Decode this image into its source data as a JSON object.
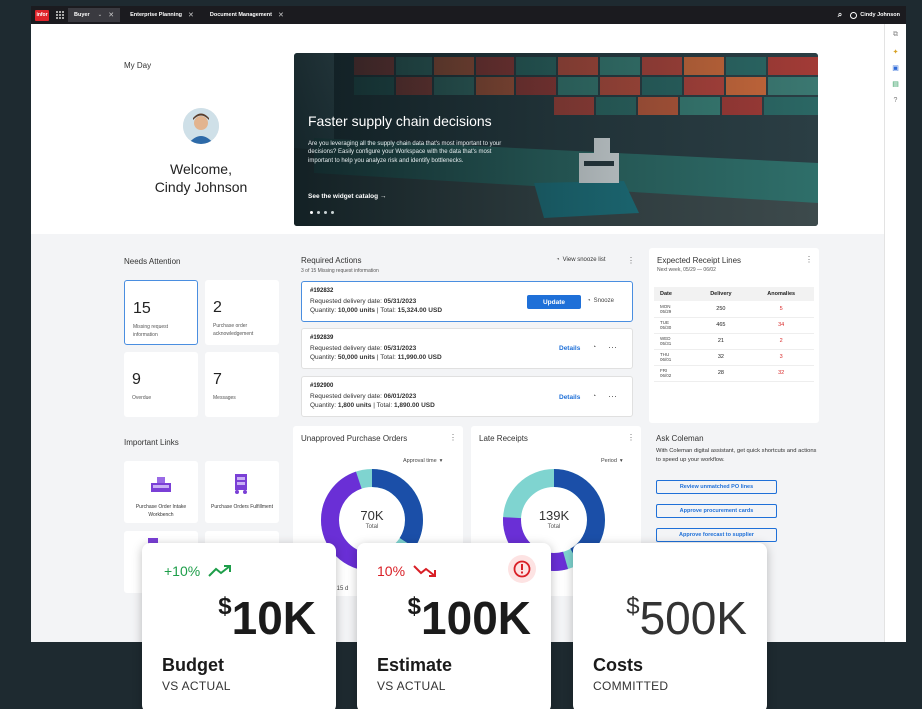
{
  "topbar": {
    "logo": "infor",
    "tabs": [
      {
        "label": "Buyer"
      },
      {
        "label": "Enterprise Planning"
      },
      {
        "label": "Document Management"
      }
    ],
    "user": "Cindy Johnson"
  },
  "myday": {
    "title": "My Day",
    "welcome_line1": "Welcome,",
    "welcome_line2": "Cindy Johnson"
  },
  "hero": {
    "title": "Faster supply chain decisions",
    "body": "Are you leveraging all the supply chain data that's most important to your decisions? Easily configure your Workspace with the data that's most important to help you analyze risk and identify bottlenecks.",
    "link": "See the widget catalog →"
  },
  "needs_attention": {
    "title": "Needs Attention",
    "tiles": [
      {
        "value": "15",
        "label": "Missing request information"
      },
      {
        "value": "2",
        "label": "Purchase order acknowledgement"
      },
      {
        "value": "9",
        "label": "Overdue"
      },
      {
        "value": "7",
        "label": "Messages"
      }
    ]
  },
  "required_actions": {
    "title": "Required Actions",
    "subtitle": "3 of 15 Missing request information",
    "view_snooze": "View snooze list",
    "items": [
      {
        "id": "#192832",
        "date_label": "Requested delivery date: ",
        "date": "05/31/2023",
        "qty_label": "Quantity: ",
        "qty": "10,000 units",
        "total_label": " | Total: ",
        "total": "15,324.00 USD",
        "primary": "Update",
        "secondary": "Snooze"
      },
      {
        "id": "#192839",
        "date_label": "Requested delivery date: ",
        "date": "05/31/2023",
        "qty_label": "Quantity: ",
        "qty": "50,000 units",
        "total_label": " | Total: ",
        "total": "11,990.00 USD",
        "primary": "Details"
      },
      {
        "id": "#192900",
        "date_label": "Requested delivery date: ",
        "date": "06/01/2023",
        "qty_label": "Quantity: ",
        "qty": "1,800 units",
        "total_label": " | Total: ",
        "total": "1,890.00 USD",
        "primary": "Details"
      }
    ]
  },
  "receipts": {
    "title": "Expected Receipt Lines",
    "subtitle": "Next week, 05/29 — 06/02",
    "columns": [
      "Date",
      "Delivery",
      "Anomalies"
    ],
    "rows": [
      {
        "dow": "MON",
        "date": "05/29",
        "delivery": "250",
        "anomalies": "5"
      },
      {
        "dow": "TUE",
        "date": "05/30",
        "delivery": "465",
        "anomalies": "34"
      },
      {
        "dow": "WED",
        "date": "05/31",
        "delivery": "21",
        "anomalies": "2"
      },
      {
        "dow": "THU",
        "date": "06/01",
        "delivery": "32",
        "anomalies": "3"
      },
      {
        "dow": "FRI",
        "date": "06/02",
        "delivery": "28",
        "anomalies": "32"
      }
    ]
  },
  "important_links": {
    "title": "Important Links",
    "items": [
      {
        "label": "Purchase Order Intake Workbench"
      },
      {
        "label": "Purchase Orders Fulfillment"
      }
    ]
  },
  "unapproved": {
    "title": "Unapproved Purchase Orders",
    "filter": "Approval time",
    "center_value": "70K",
    "center_label": "Total",
    "footnote": "- 15 d"
  },
  "late": {
    "title": "Late Receipts",
    "filter": "Period",
    "center_value": "139K",
    "center_label": "Total"
  },
  "ask": {
    "title": "Ask Coleman",
    "body": "With Coleman digital assistant, get quick shortcuts and actions to speed up your workflow.",
    "buttons": [
      "Review unmatched PO lines",
      "Approve procurement cards",
      "Approve forecast to supplier"
    ]
  },
  "kpis": [
    {
      "change": "+10%",
      "trend": "up",
      "currency": "$",
      "value": "10K",
      "title": "Budget",
      "subtitle": "VS ACTUAL",
      "color": "#1e9e4a"
    },
    {
      "change": "10%",
      "trend": "down",
      "currency": "$",
      "value": "100K",
      "title": "Estimate",
      "subtitle": "VS ACTUAL",
      "color": "#d91f26"
    },
    {
      "change": "",
      "trend": "",
      "currency": "$",
      "value": "500K",
      "title": "Costs",
      "subtitle": "COMMITTED",
      "color": ""
    }
  ],
  "colors": {
    "accent": "#1f70d8",
    "donut_purple": "#6a2fd6",
    "donut_blue": "#1b4fa8",
    "donut_teal": "#7fd4d0",
    "positive": "#1e9e4a",
    "negative": "#d91f26"
  }
}
